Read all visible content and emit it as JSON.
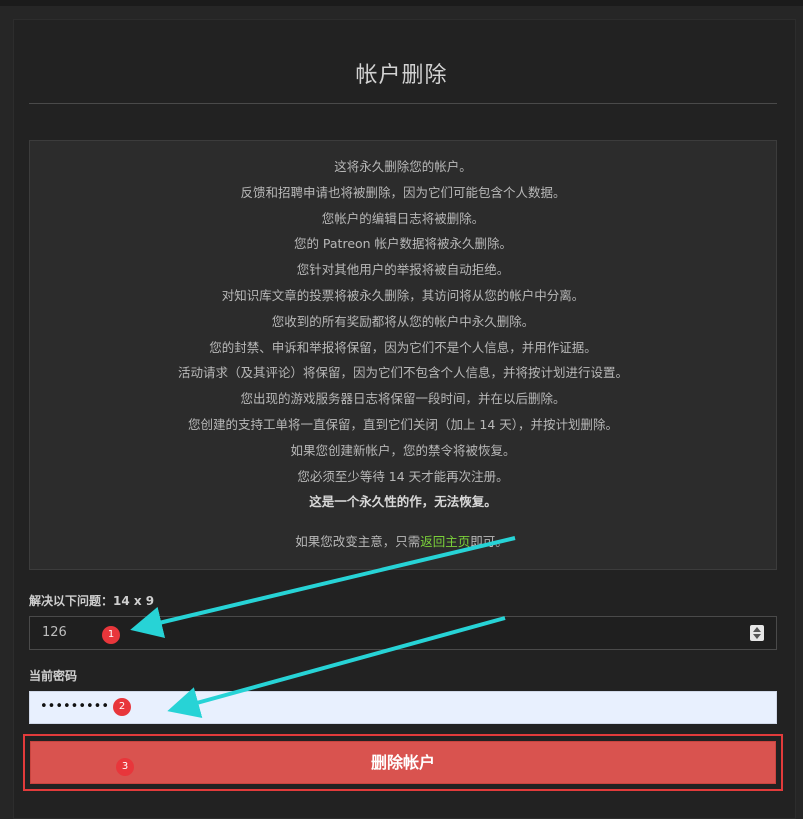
{
  "page": {
    "title": "帐户删除"
  },
  "info": {
    "lines": [
      "这将永久删除您的帐户。",
      "反馈和招聘申请也将被删除，因为它们可能包含个人数据。",
      "您帐户的编辑日志将被删除。",
      "您的 Patreon 帐户数据将被永久删除。",
      "您针对其他用户的举报将被自动拒绝。",
      "对知识库文章的投票将被永久删除，其访问将从您的帐户中分离。",
      "您收到的所有奖励都将从您的帐户中永久删除。",
      "您的封禁、申诉和举报将保留，因为它们不是个人信息，并用作证据。",
      "活动请求（及其评论）将保留，因为它们不包含个人信息，并将按计划进行设置。",
      "您出现的游戏服务器日志将保留一段时间，并在以后删除。",
      "您创建的支持工单将一直保留，直到它们关闭（加上 14 天），并按计划删除。",
      "如果您创建新帐户，您的禁令将被恢复。",
      "您必须至少等待 14 天才能再次注册。"
    ],
    "warning": "这是一个永久性的作，无法恢复。",
    "return_prefix": "如果您改变主意，只需",
    "return_link": "返回主页",
    "return_suffix": "即可。"
  },
  "form": {
    "captcha_label": "解决以下问题：14 x 9",
    "captcha_value": "126",
    "password_label": "当前密码",
    "password_value": "•••••••••",
    "delete_button": "删除帐户"
  },
  "annotations": {
    "marker_1": "1",
    "marker_2": "2",
    "marker_3": "3",
    "arrow_color": "#27d3d6",
    "marker_color": "#e8363b"
  },
  "colors": {
    "background": "#262626",
    "panel": "#222222",
    "link": "#7bd23a",
    "danger": "#d9534f"
  }
}
